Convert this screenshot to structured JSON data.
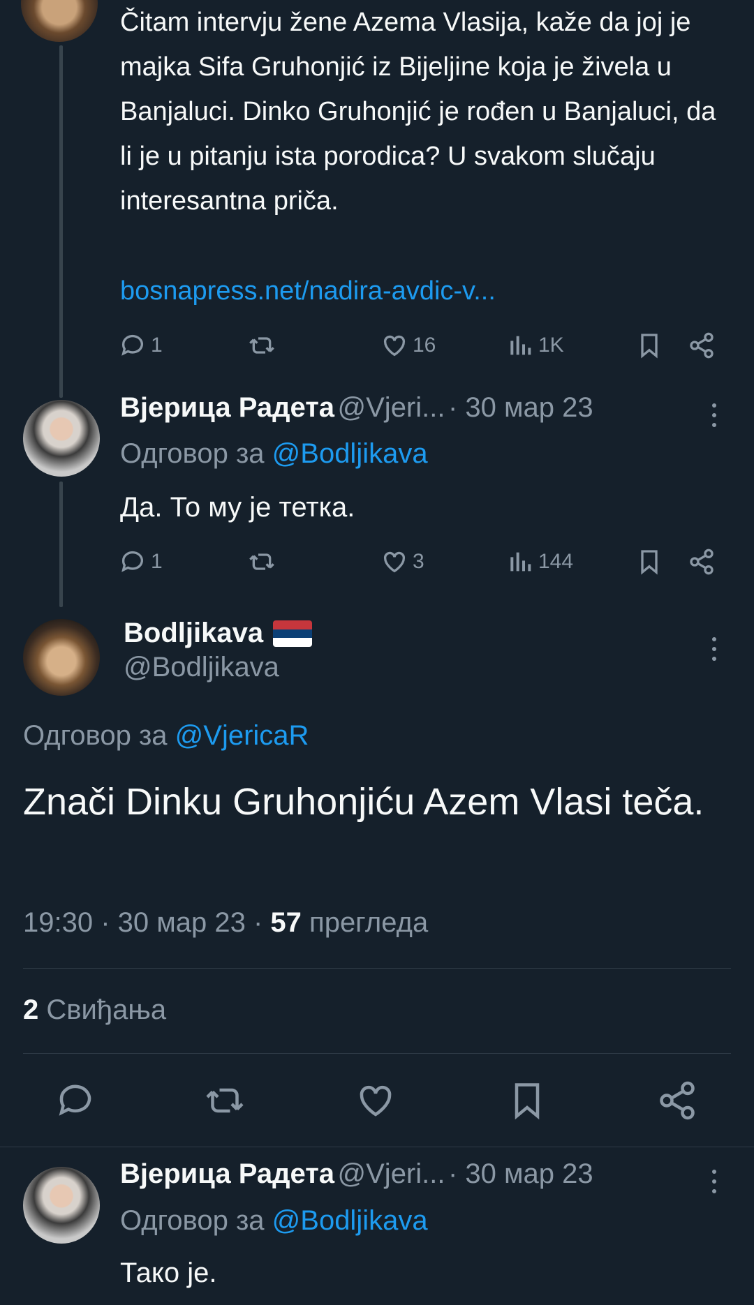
{
  "tweet1": {
    "text": "Čitam intervju žene Azema Vlasija, kaže da joj je majka Sifa Gruhonjić iz Bijeljine koja je živela u Banjaluci. Dinko Gruhonjić je rođen u Banjaluci, da li je u pitanju ista porodica? U svakom slučaju interesantna priča.",
    "link": "bosnapress.net/nadira-avdic-v...",
    "replies": "1",
    "likes": "16",
    "views": "1K"
  },
  "tweet2": {
    "name": "Вјерица Радета",
    "handle": "@Vjeri...",
    "date": "· 30 мар 23",
    "reply_prefix": "Одговор за",
    "reply_to": "@Bodljikava",
    "text": "Да. То му је тетка.",
    "replies": "1",
    "likes": "3",
    "views": "144"
  },
  "main": {
    "name": "Bodljikava",
    "handle": "@Bodljikava",
    "reply_prefix": "Одговор за",
    "reply_to": "@VjericaR",
    "text": "Znači Dinku Gruhonjiću Azem Vlasi teča.",
    "time": "19:30 · 30 мар 23 ·",
    "views_count": "57",
    "views_label": "прегледа",
    "likes_count": "2",
    "likes_label": "Свиђања"
  },
  "tweet3": {
    "name": "Вјерица Радета",
    "handle": "@Vjeri...",
    "date": "· 30 мар 23",
    "reply_prefix": "Одговор за",
    "reply_to": "@Bodljikava",
    "text": "Тако је."
  },
  "colors": {
    "background": "#15202b",
    "link": "#1d9bf0",
    "muted": "#8b98a5"
  }
}
